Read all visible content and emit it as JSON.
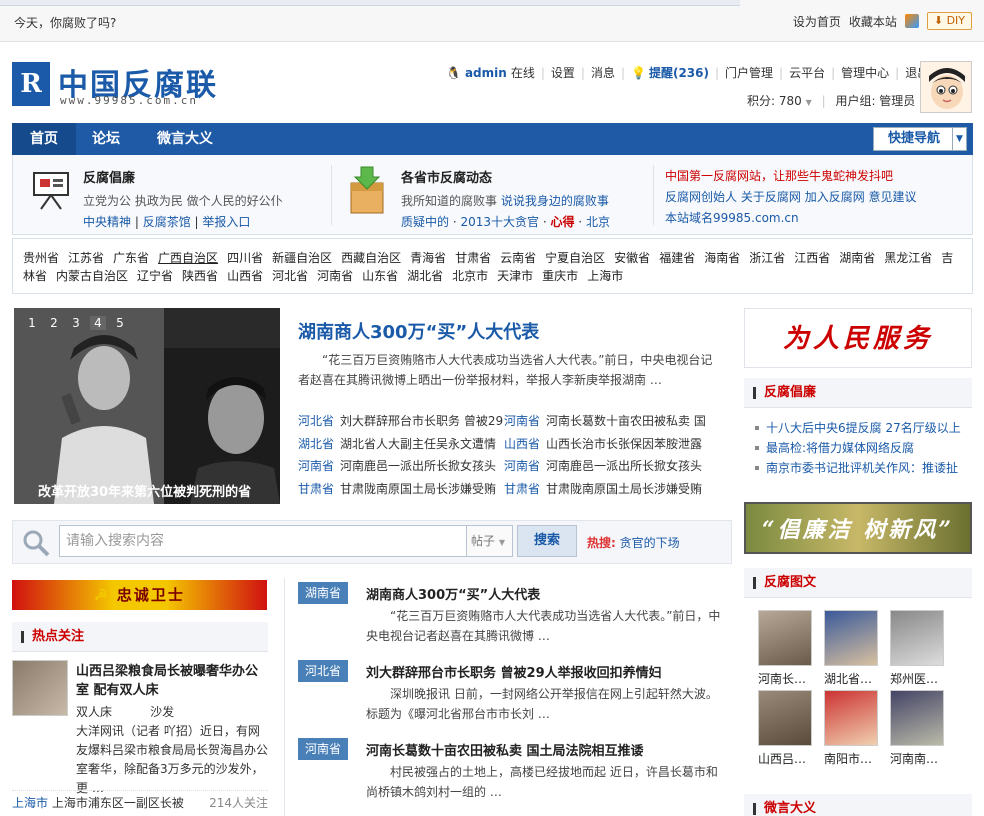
{
  "topbar": {
    "greet": "今天，你腐败了吗?",
    "set_home": "设为首页",
    "bookmark": "收藏本站",
    "diy": "DIY"
  },
  "logo": {
    "mark": "R",
    "cn": "中国反腐联",
    "url": "www.99985.com.cn"
  },
  "user": {
    "name": "admin",
    "status": "在线",
    "settings": "设置",
    "messages": "消息",
    "remind": "提醒(236)",
    "portal": "门户管理",
    "cloud": "云平台",
    "admin": "管理中心",
    "logout": "退出",
    "points": "积分: 780",
    "group": "用户组: 管理员"
  },
  "nav": {
    "home": "首页",
    "forum": "论坛",
    "weiyan": "微言大义",
    "quick": "快捷导航"
  },
  "band": {
    "c1": {
      "title": "反腐倡廉",
      "desc": "立党为公 执政为民 做个人民的好公仆",
      "links": [
        "中央精神",
        "反腐茶馆",
        "举报入口"
      ]
    },
    "c2": {
      "title": "各省市反腐动态",
      "desc": "我所知道的腐败事",
      "desc_link": "说说我身边的腐败事",
      "l1": "质疑中的",
      "l2": "2013十大贪官",
      "l3": "心得",
      "l4": "北京"
    },
    "c3": {
      "title": "中国第一反腐网站，让那些牛鬼蛇神发抖吧",
      "links": [
        "反腐网创始人",
        "关于反腐网",
        "加入反腐网",
        "意见建议"
      ],
      "domain": "本站域名99985.com.cn"
    }
  },
  "provinces": [
    "贵州省",
    "江苏省",
    "广东省",
    "广西自治区",
    "四川省",
    "新疆自治区",
    "西藏自治区",
    "青海省",
    "甘肃省",
    "云南省",
    "宁夏自治区",
    "安徽省",
    "福建省",
    "海南省",
    "浙江省",
    "江西省",
    "湖南省",
    "黑龙江省",
    "吉林省",
    "内蒙古自治区",
    "辽宁省",
    "陕西省",
    "山西省",
    "河北省",
    "河南省",
    "山东省",
    "湖北省",
    "北京市",
    "天津市",
    "重庆市",
    "上海市"
  ],
  "slider": {
    "dots": [
      "1",
      "2",
      "3",
      "4",
      "5"
    ],
    "active": 3,
    "caption": "改革开放30年来第六位被判死刑的省"
  },
  "headline": {
    "title": "湖南商人300万“买”人大代表",
    "summary": "“花三百万巨资贿赂市人大代表成功当选省人大代表。”前日，中央电视台记者赵喜在其腾讯微博上晒出一份举报材料，举报人李新庚举报湖南 …"
  },
  "hlist": [
    [
      {
        "p": "河北省",
        "t": "刘大群辞邢台市长职务 曾被29"
      },
      {
        "p": "河南省",
        "t": "河南长葛数十亩农田被私卖 国"
      }
    ],
    [
      {
        "p": "湖北省",
        "t": "湖北省人大副主任吴永文遭情"
      },
      {
        "p": "山西省",
        "t": "山西长治市长张保因苯胺泄露"
      }
    ],
    [
      {
        "p": "河南省",
        "t": "河南鹿邑一派出所长掀女孩头"
      },
      {
        "p": "河南省",
        "t": "河南鹿邑一派出所长掀女孩头"
      }
    ],
    [
      {
        "p": "甘肃省",
        "t": "甘肃陇南原国土局长涉嫌受贿"
      },
      {
        "p": "甘肃省",
        "t": "甘肃陇南原国土局长涉嫌受贿"
      }
    ]
  ],
  "search": {
    "placeholder": "请输入搜索内容",
    "select": "帖子",
    "button": "搜索",
    "hot_label": "热搜:",
    "hot_term": "贪官的下场"
  },
  "left": {
    "banner": "忠诚卫士",
    "focus_head": "热点关注",
    "focus_title": "山西吕梁粮食局长被曝奢华办公室 配有双人床",
    "focus_text": "双人床          沙发\n大洋网讯（记者 吖招）近日，有网友爆料吕梁市粮食局局长贺海昌办公室奢华，除配备3万多元的沙发外，更 …",
    "foot_place": "上海市",
    "foot_title": "上海市浦东区一副区长被",
    "foot_count": "214人关注"
  },
  "mlist": [
    {
      "tag": "湖南省",
      "title": "湖南商人300万“买”人大代表",
      "sum": "“花三百万巨资贿赂市人大代表成功当选省人大代表。”前日，中央电视台记者赵喜在其腾讯微博 …"
    },
    {
      "tag": "河北省",
      "title": "刘大群辞邢台市长职务 曾被29人举报收回扣养情妇",
      "sum": "深圳晚报讯 日前，一封网络公开举报信在网上引起轩然大波。标题为《曝河北省邢台市市长刘 …"
    },
    {
      "tag": "河南省",
      "title": "河南长葛数十亩农田被私卖 国土局法院相互推诿",
      "sum": "村民被强占的土地上，高楼已经拔地而起      近日，许昌长葛市和尚桥镇木鸽刘村一组的 …"
    }
  ],
  "right": {
    "calli": "为人民服务",
    "head1": "反腐倡廉",
    "list1": [
      "十八大后中央6提反腐 27名厅级以上",
      "最高检:将借力媒体网络反腐",
      "南京市委书记批评机关作风：推诿扯"
    ],
    "banner2": "“倡廉洁 树新风”",
    "head2": "反腐图文",
    "thumbs": [
      "河南长…",
      "湖北省…",
      "郑州医…",
      "山西吕…",
      "南阳市…",
      "河南南…"
    ],
    "head3": "微言大义"
  }
}
